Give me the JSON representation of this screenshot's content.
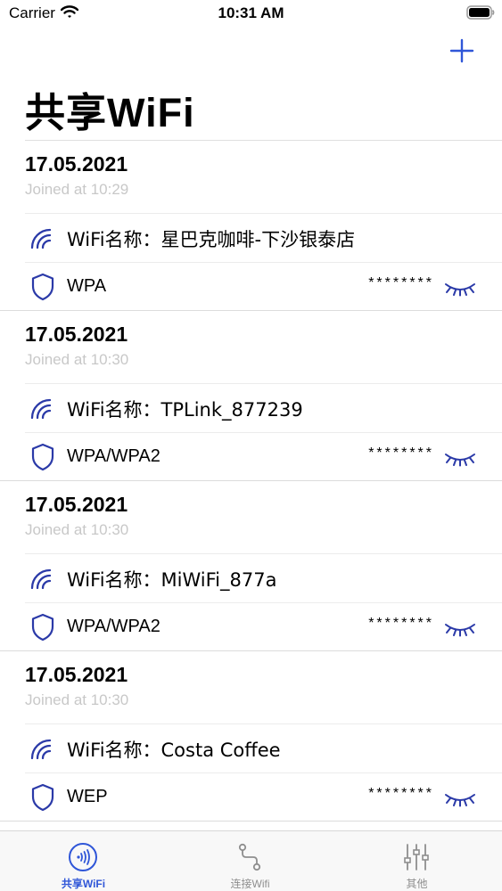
{
  "status_bar": {
    "carrier": "Carrier",
    "time": "10:31 AM"
  },
  "header": {
    "title": "共享WiFi",
    "add_icon": "plus-icon"
  },
  "colors": {
    "accent": "#2f56d8",
    "icon_navy": "#2b3aa8",
    "muted_text": "#c8c8c8",
    "tab_inactive": "#8e8e8e"
  },
  "entries": [
    {
      "date": "17.05.2021",
      "joined": "Joined at 10:29",
      "wifi_label": "WiFi名称：星巴克咖啡-下沙银泰店",
      "security": "WPA",
      "password_mask": "********"
    },
    {
      "date": "17.05.2021",
      "joined": "Joined at 10:30",
      "wifi_label": "WiFi名称：TPLink_877239",
      "security": "WPA/WPA2",
      "password_mask": "********"
    },
    {
      "date": "17.05.2021",
      "joined": "Joined at 10:30",
      "wifi_label": "WiFi名称：MiWiFi_877a",
      "security": "WPA/WPA2",
      "password_mask": "********"
    },
    {
      "date": "17.05.2021",
      "joined": "Joined at 10:30",
      "wifi_label": "WiFi名称：Costa Coffee",
      "security": "WEP",
      "password_mask": "********"
    }
  ],
  "tabs": [
    {
      "label": "共享WiFi",
      "icon": "share-wifi-icon",
      "active": true
    },
    {
      "label": "连接Wifi",
      "icon": "connect-path-icon",
      "active": false
    },
    {
      "label": "其他",
      "icon": "sliders-icon",
      "active": false
    }
  ]
}
